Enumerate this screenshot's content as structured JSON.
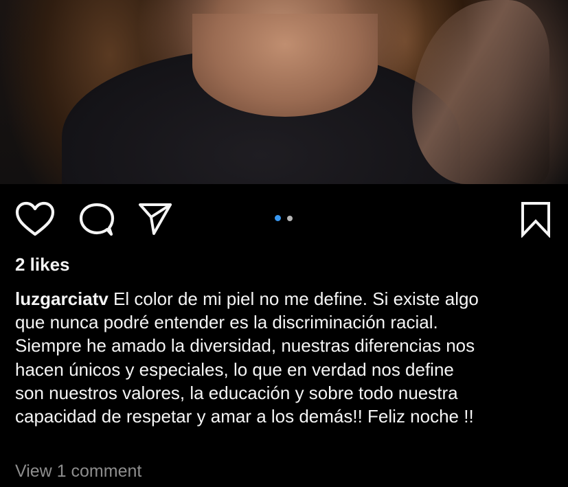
{
  "post": {
    "media": {
      "description": "photo of a woman in a dark sparkly dress",
      "carousel": {
        "count": 2,
        "active_index": 0
      }
    },
    "actions": {
      "like_icon": "heart-icon",
      "comment_icon": "comment-icon",
      "share_icon": "send-icon",
      "save_icon": "bookmark-icon"
    },
    "likes_text": "2 likes",
    "caption": {
      "username": "luzgarciatv",
      "lines": [
        " El color de mi piel no me define. Si existe algo",
        "que nunca podré entender es la discriminación racial.",
        "Siempre he amado la diversidad, nuestras diferencias nos",
        "hacen únicos y especiales, lo que en verdad nos define",
        "son nuestros valores, la educación y sobre todo nuestra",
        "capacidad de respetar y amar a los demás!! Feliz noche !!"
      ]
    },
    "view_comments_text": "View 1 comment"
  },
  "colors": {
    "background": "#000000",
    "text": "#f5f5f5",
    "muted": "#8e8e8e",
    "carousel_active": "#3897f0",
    "carousel_inactive": "#b5b5b5"
  }
}
